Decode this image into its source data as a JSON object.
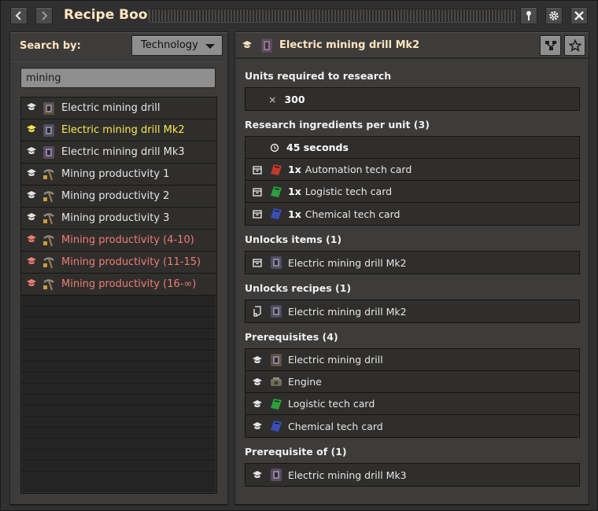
{
  "window": {
    "title": "Recipe Book"
  },
  "left": {
    "search_by_label": "Search by:",
    "search_by_value": "Technology",
    "search_value": "mining",
    "items": [
      {
        "label": "Electric mining drill",
        "color": "normal",
        "cap": "#e6e6e6",
        "icon": "mining-drill-icon"
      },
      {
        "label": "Electric mining drill Mk2",
        "color": "yellow",
        "cap": "#f7e94d",
        "icon": "mining-drill-mk2-icon"
      },
      {
        "label": "Electric mining drill Mk3",
        "color": "normal",
        "cap": "#e6e6e6",
        "icon": "mining-drill-mk3-icon"
      },
      {
        "label": "Mining productivity 1",
        "color": "normal",
        "cap": "#e6e6e6",
        "icon": "pickaxe-icon"
      },
      {
        "label": "Mining productivity 2",
        "color": "normal",
        "cap": "#e6e6e6",
        "icon": "pickaxe-icon"
      },
      {
        "label": "Mining productivity 3",
        "color": "normal",
        "cap": "#e6e6e6",
        "icon": "pickaxe-icon"
      },
      {
        "label": "Mining productivity (4-10)",
        "color": "red",
        "cap": "#ee7d72",
        "icon": "pickaxe-icon"
      },
      {
        "label": "Mining productivity (11-15)",
        "color": "red",
        "cap": "#ee7d72",
        "icon": "pickaxe-icon"
      },
      {
        "label": "Mining productivity (16-∞)",
        "color": "red",
        "cap": "#ee7d72",
        "icon": "pickaxe-icon"
      }
    ]
  },
  "right": {
    "title": "Electric mining drill Mk2",
    "units_title": "Units required to research",
    "units_symbol": "×",
    "units_value": "300",
    "ingredients_title": "Research ingredients per unit (3)",
    "time_value": "45 seconds",
    "ingredients": [
      {
        "qty": "1x",
        "label": "Automation tech card",
        "color": "#c0392b"
      },
      {
        "qty": "1x",
        "label": "Logistic tech card",
        "color": "#2e9e3e"
      },
      {
        "qty": "1x",
        "label": "Chemical tech card",
        "color": "#3a4fb8"
      }
    ],
    "unlocks_items_title": "Unlocks items (1)",
    "unlocks_items": [
      {
        "label": "Electric mining drill Mk2"
      }
    ],
    "unlocks_recipes_title": "Unlocks recipes (1)",
    "unlocks_recipes": [
      {
        "label": "Electric mining drill Mk2"
      }
    ],
    "prereq_title": "Prerequisites (4)",
    "prereqs": [
      {
        "label": "Electric mining drill",
        "icon": "mining-drill-icon"
      },
      {
        "label": "Engine",
        "icon": "engine-icon"
      },
      {
        "label": "Logistic tech card",
        "icon": "logistic-card-icon"
      },
      {
        "label": "Chemical tech card",
        "icon": "chemical-card-icon"
      }
    ],
    "prereq_of_title": "Prerequisite of (1)",
    "prereq_of": [
      {
        "label": "Electric mining drill Mk3",
        "icon": "mining-drill-mk3-icon"
      }
    ]
  },
  "colors": {
    "accent_title": "#ffe6c0",
    "available": "#f7e94d",
    "unavailable": "#ee7d72"
  }
}
